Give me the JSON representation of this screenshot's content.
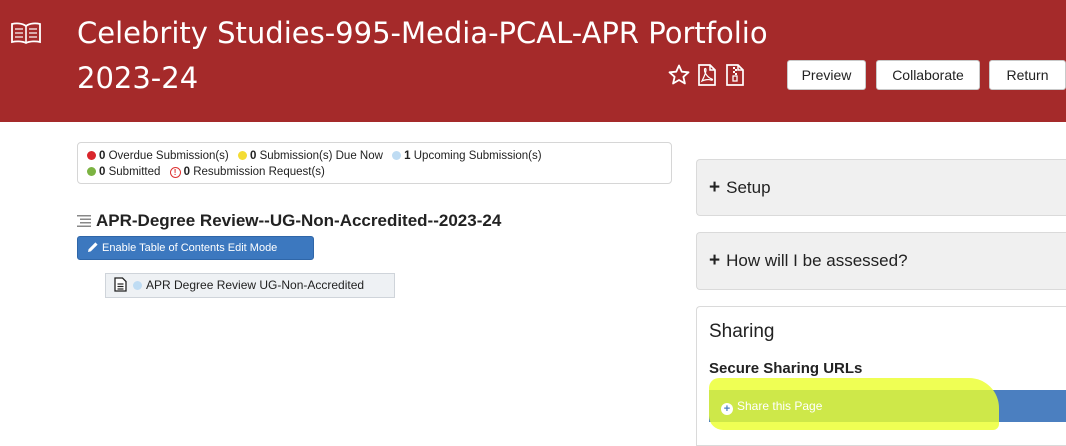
{
  "header": {
    "title": "Celebrity Studies-995-Media-PCAL-APR Portfolio 2023-24",
    "icons": [
      "book-icon",
      "star-icon",
      "pdf-icon",
      "zip-icon"
    ],
    "buttons": {
      "preview": "Preview",
      "collaborate": "Collaborate",
      "return": "Return"
    }
  },
  "status": {
    "overdue": {
      "count": "0",
      "label": "Overdue Submission(s)",
      "color": "#d9262c"
    },
    "due_now": {
      "count": "0",
      "label": "Submission(s) Due Now",
      "color": "#f4dc34"
    },
    "upcoming": {
      "count": "1",
      "label": "Upcoming Submission(s)",
      "color": "#bfdcf3"
    },
    "submitted": {
      "count": "0",
      "label": "Submitted",
      "color": "#7cb342"
    },
    "resubmission": {
      "count": "0",
      "label": "Resubmission Request(s)",
      "color": "#d33333"
    }
  },
  "main": {
    "section_title": "APR-Degree Review--UG-Non-Accredited--2023-24",
    "toc_button": "Enable Table of Contents Edit Mode",
    "toc_item": "APR Degree Review UG-Non-Accredited"
  },
  "sidebar": {
    "setup": "Setup",
    "assessment": "How will I be assessed?",
    "sharing_title": "Sharing",
    "sharing_subtitle": "Secure Sharing URLs",
    "share_button": "Share this Page"
  },
  "colors": {
    "header_bg": "#a52a2a",
    "primary_button": "#3c78bf",
    "highlight": "#ecff2e"
  }
}
